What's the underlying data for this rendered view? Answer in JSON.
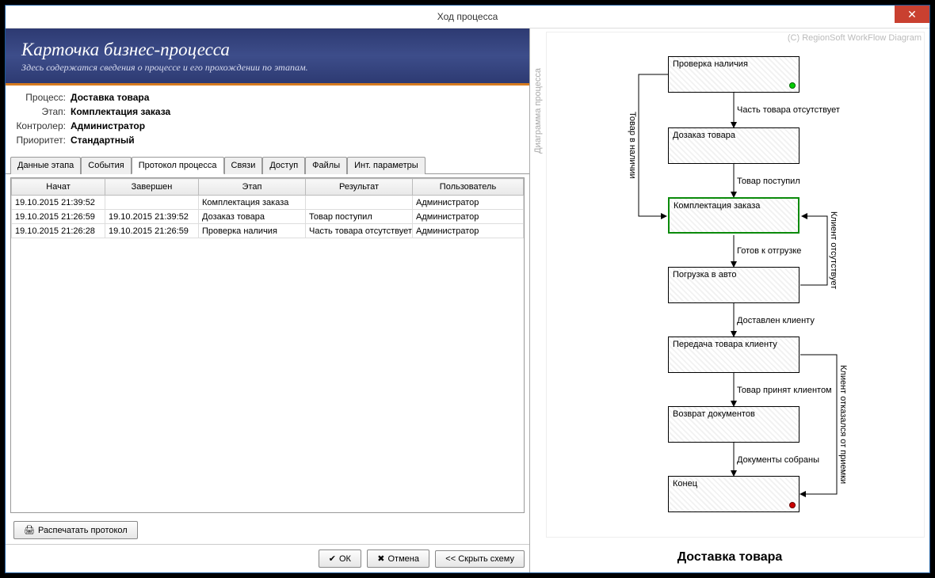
{
  "window": {
    "title": "Ход процесса"
  },
  "header": {
    "title": "Карточка бизнес-процесса",
    "subtitle": "Здесь содержатся сведения о процессе и его прохождении по этапам."
  },
  "info": {
    "process_label": "Процесс:",
    "process_value": "Доставка товара",
    "stage_label": "Этап:",
    "stage_value": "Комплектация заказа",
    "controller_label": "Контролер:",
    "controller_value": "Администратор",
    "priority_label": "Приоритет:",
    "priority_value": "Стандартный"
  },
  "tabs": {
    "items": [
      "Данные этапа",
      "События",
      "Протокол процесса",
      "Связи",
      "Доступ",
      "Файлы",
      "Инт. параметры"
    ],
    "active_index": 2
  },
  "grid": {
    "columns": [
      "Начат",
      "Завершен",
      "Этап",
      "Результат",
      "Пользователь"
    ],
    "rows": [
      {
        "started": "19.10.2015 21:39:52",
        "finished": "",
        "stage": "Комплектация заказа",
        "result": "",
        "user": "Администратор"
      },
      {
        "started": "19.10.2015 21:26:59",
        "finished": "19.10.2015 21:39:52",
        "stage": "Дозаказ товара",
        "result": "Товар поступил",
        "user": "Администратор"
      },
      {
        "started": "19.10.2015 21:26:28",
        "finished": "19.10.2015 21:26:59",
        "stage": "Проверка наличия",
        "result": "Часть товара отсутствует",
        "user": "Администратор"
      }
    ]
  },
  "buttons": {
    "print": "Распечатать протокол",
    "ok": "ОК",
    "cancel": "Отмена",
    "hide_scheme": "<< Скрыть схему"
  },
  "diagram": {
    "side_label": "Диаграмма процесса",
    "copyright": "(C) RegionSoft WorkFlow Diagram",
    "title": "Доставка товара",
    "nodes": [
      {
        "label": "Проверка наличия",
        "current": false,
        "dot": "green"
      },
      {
        "label": "Дозаказ товара",
        "current": false,
        "dot": null
      },
      {
        "label": "Комплектация заказа",
        "current": true,
        "dot": null
      },
      {
        "label": "Погрузка в авто",
        "current": false,
        "dot": null
      },
      {
        "label": "Передача товара клиенту",
        "current": false,
        "dot": null
      },
      {
        "label": "Возврат документов",
        "current": false,
        "dot": null
      },
      {
        "label": "Конец",
        "current": false,
        "dot": "red"
      }
    ],
    "edges": [
      "Часть товара отсутствует",
      "Товар поступил",
      "Готов к отгрузке",
      "Доставлен клиенту",
      "Товар принят клиентом",
      "Документы собраны",
      "Товар в наличии",
      "Клиент отсутствует",
      "Клиент отказался от приемки"
    ]
  }
}
